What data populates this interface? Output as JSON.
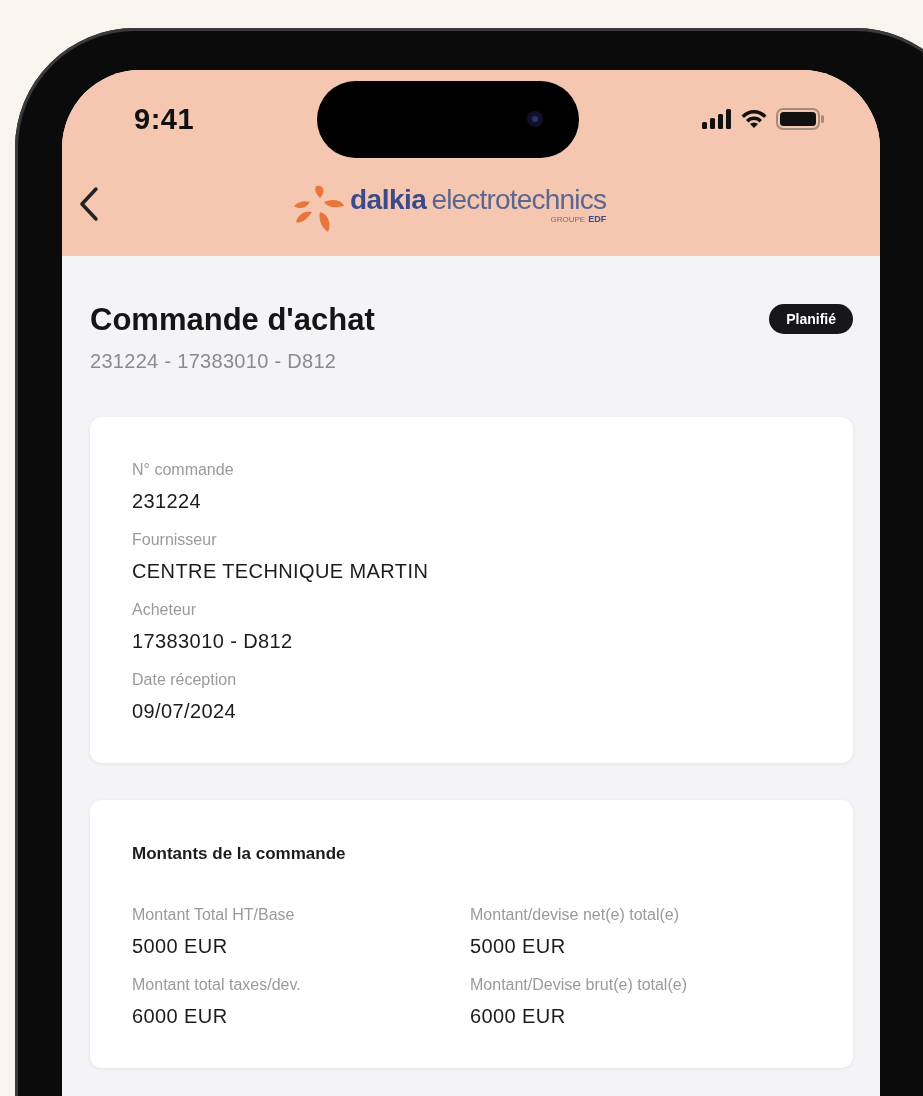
{
  "status_bar": {
    "time": "9:41"
  },
  "header": {
    "logo": {
      "name": "dalkia",
      "suffix": "electrotechnics",
      "group": "GROUPE",
      "group_brand": "EDF"
    }
  },
  "order": {
    "title": "Commande d'achat",
    "subtitle": "231224 - 17383010 - D812",
    "status": "Planifié"
  },
  "details": [
    {
      "label": "N° commande",
      "value": "231224"
    },
    {
      "label": "Fournisseur",
      "value": "CENTRE TECHNIQUE MARTIN"
    },
    {
      "label": "Acheteur",
      "value": "17383010 - D812"
    },
    {
      "label": "Date réception",
      "value": "09/07/2024"
    }
  ],
  "amounts": {
    "title": "Montants de la commande",
    "items": [
      {
        "label": "Montant Total HT/Base",
        "value": "5000 EUR"
      },
      {
        "label": "Montant/devise net(e) total(e)",
        "value": "5000 EUR"
      },
      {
        "label": "Montant total taxes/dev.",
        "value": "6000 EUR"
      },
      {
        "label": "Montant/Devise brut(e) total(e)",
        "value": "6000 EUR"
      }
    ]
  }
}
